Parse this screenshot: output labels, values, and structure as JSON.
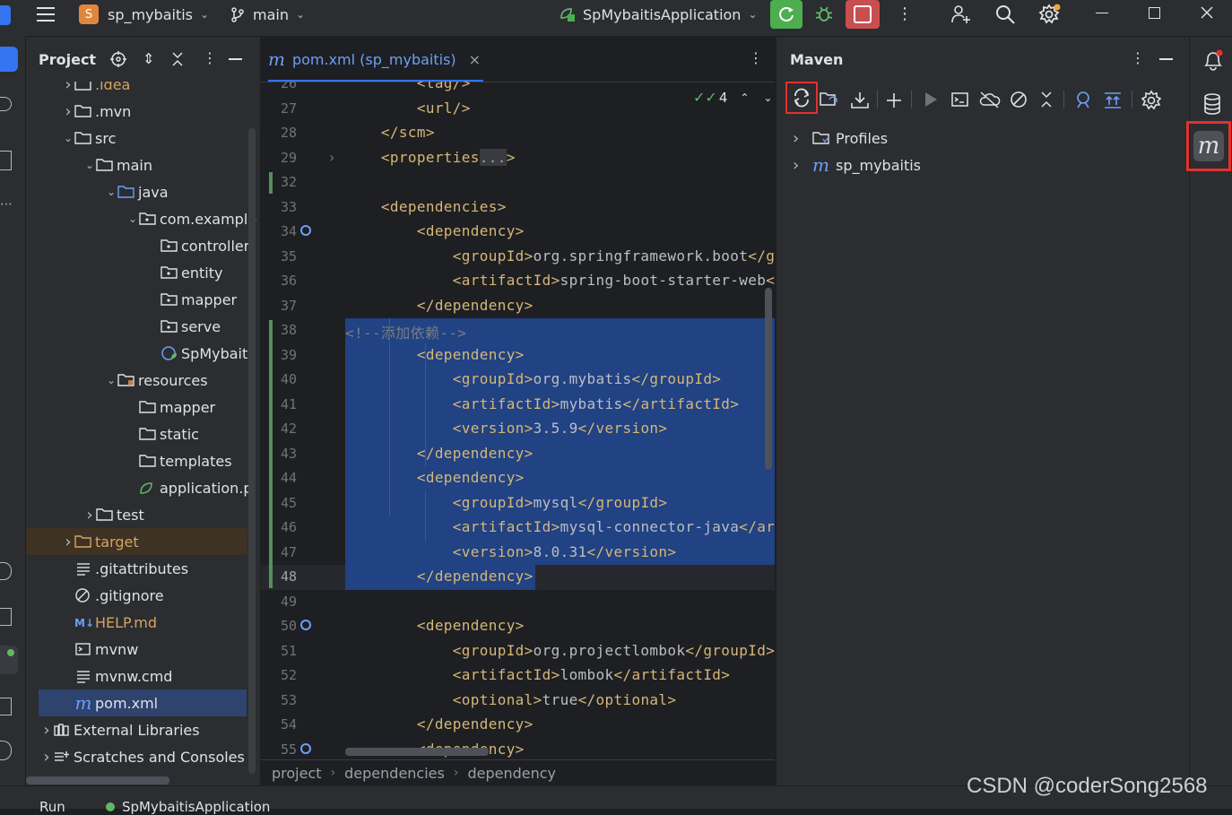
{
  "titlebar": {
    "project_badge": "S",
    "project_name": "sp_mybaitis",
    "branch": "main",
    "run_config": "SpMybaitisApplication"
  },
  "project_panel": {
    "title": "Project",
    "items": [
      {
        "label": ".idea",
        "depth": 2,
        "chevron": "right",
        "icon": "folder",
        "partial": true
      },
      {
        "label": ".mvn",
        "depth": 2,
        "chevron": "right",
        "icon": "folder"
      },
      {
        "label": "src",
        "depth": 2,
        "chevron": "down",
        "icon": "folder"
      },
      {
        "label": "main",
        "depth": 3,
        "chevron": "down",
        "icon": "folder"
      },
      {
        "label": "java",
        "depth": 4,
        "chevron": "down",
        "icon": "source-folder"
      },
      {
        "label": "com.example",
        "depth": 5,
        "chevron": "down",
        "icon": "package"
      },
      {
        "label": "controller",
        "depth": 6,
        "chevron": "",
        "icon": "package"
      },
      {
        "label": "entity",
        "depth": 6,
        "chevron": "",
        "icon": "package"
      },
      {
        "label": "mapper",
        "depth": 6,
        "chevron": "",
        "icon": "package"
      },
      {
        "label": "serve",
        "depth": 6,
        "chevron": "",
        "icon": "package"
      },
      {
        "label": "SpMybaiti",
        "depth": 6,
        "chevron": "",
        "icon": "spring-class"
      },
      {
        "label": "resources",
        "depth": 4,
        "chevron": "down",
        "icon": "resource-folder"
      },
      {
        "label": "mapper",
        "depth": 5,
        "chevron": "",
        "icon": "folder"
      },
      {
        "label": "static",
        "depth": 5,
        "chevron": "",
        "icon": "folder"
      },
      {
        "label": "templates",
        "depth": 5,
        "chevron": "",
        "icon": "folder"
      },
      {
        "label": "application.p",
        "depth": 5,
        "chevron": "",
        "icon": "spring-config"
      },
      {
        "label": "test",
        "depth": 3,
        "chevron": "right",
        "icon": "folder"
      },
      {
        "label": "target",
        "depth": 2,
        "chevron": "right",
        "icon": "excluded-folder",
        "excluded": true
      },
      {
        "label": ".gitattributes",
        "depth": 2,
        "chevron": "",
        "icon": "text-file"
      },
      {
        "label": ".gitignore",
        "depth": 2,
        "chevron": "",
        "icon": "ignore-file"
      },
      {
        "label": "HELP.md",
        "depth": 2,
        "chevron": "",
        "icon": "markdown-file",
        "modified": true
      },
      {
        "label": "mvnw",
        "depth": 2,
        "chevron": "",
        "icon": "shell-file"
      },
      {
        "label": "mvnw.cmd",
        "depth": 2,
        "chevron": "",
        "icon": "text-file"
      },
      {
        "label": "pom.xml",
        "depth": 2,
        "chevron": "",
        "icon": "maven-file",
        "selected": true
      },
      {
        "label": "External Libraries",
        "depth": 1,
        "chevron": "right",
        "icon": "library"
      },
      {
        "label": "Scratches and Consoles",
        "depth": 1,
        "chevron": "right",
        "icon": "scratches"
      }
    ]
  },
  "editor": {
    "tab_label": "pom.xml (sp_mybaitis)",
    "inspection_count": "4",
    "lines": [
      {
        "n": "26",
        "parts": [
          [
            "tag",
            "        <tag/>"
          ]
        ],
        "partial_top": true
      },
      {
        "n": "27",
        "parts": [
          [
            "tag",
            "        <url/>"
          ]
        ]
      },
      {
        "n": "28",
        "parts": [
          [
            "tag",
            "    </scm>"
          ]
        ]
      },
      {
        "n": "29",
        "parts": [
          [
            "tag",
            "    <properties"
          ],
          [
            "fold",
            "..."
          ],
          [
            "tag",
            ">"
          ]
        ],
        "fold": true
      },
      {
        "n": "32",
        "parts": []
      },
      {
        "n": "33",
        "parts": [
          [
            "tag",
            "    <dependencies>"
          ]
        ]
      },
      {
        "n": "34",
        "parts": [
          [
            "tag",
            "        <dependency>"
          ]
        ],
        "marker": true
      },
      {
        "n": "35",
        "parts": [
          [
            "tag",
            "            <groupId>"
          ],
          [
            "txt",
            "org.springframework.boot"
          ],
          [
            "tag",
            "</g"
          ]
        ]
      },
      {
        "n": "36",
        "parts": [
          [
            "tag",
            "            <artifactId>"
          ],
          [
            "txt",
            "spring-boot-starter-web"
          ],
          [
            "tag",
            "<"
          ]
        ]
      },
      {
        "n": "37",
        "parts": [
          [
            "tag",
            "        </dependency>"
          ]
        ]
      },
      {
        "n": "38",
        "parts": [
          [
            "cmt",
            "<!--添加依赖-->"
          ]
        ],
        "sel": "full"
      },
      {
        "n": "39",
        "parts": [
          [
            "tag",
            "        <dependency>"
          ]
        ],
        "sel": "full"
      },
      {
        "n": "40",
        "parts": [
          [
            "tag",
            "            <groupId>"
          ],
          [
            "txt",
            "org.mybatis"
          ],
          [
            "tag",
            "</groupId>"
          ]
        ],
        "sel": "full"
      },
      {
        "n": "41",
        "parts": [
          [
            "tag",
            "            <artifactId>"
          ],
          [
            "txt",
            "mybatis"
          ],
          [
            "tag",
            "</artifactId>"
          ]
        ],
        "sel": "full"
      },
      {
        "n": "42",
        "parts": [
          [
            "tag",
            "            <version>"
          ],
          [
            "txt",
            "3.5.9"
          ],
          [
            "tag",
            "</version>"
          ]
        ],
        "sel": "full"
      },
      {
        "n": "43",
        "parts": [
          [
            "tag",
            "        </dependency>"
          ]
        ],
        "sel": "full"
      },
      {
        "n": "44",
        "parts": [
          [
            "tag",
            "        <dependency>"
          ]
        ],
        "sel": "full"
      },
      {
        "n": "45",
        "parts": [
          [
            "tag",
            "            <groupId>"
          ],
          [
            "txt",
            "mysql"
          ],
          [
            "tag",
            "</groupId>"
          ]
        ],
        "sel": "full"
      },
      {
        "n": "46",
        "parts": [
          [
            "tag",
            "            <artifactId>"
          ],
          [
            "txt",
            "mysql-connector-java"
          ],
          [
            "tag",
            "</ar"
          ]
        ],
        "sel": "full"
      },
      {
        "n": "47",
        "parts": [
          [
            "tag",
            "            <version>"
          ],
          [
            "txt",
            "8.0.31"
          ],
          [
            "tag",
            "</version>"
          ]
        ],
        "sel": "full"
      },
      {
        "n": "48",
        "parts": [
          [
            "tag",
            "        </dependency>"
          ]
        ],
        "sel": "part",
        "current": true
      },
      {
        "n": "49",
        "parts": []
      },
      {
        "n": "50",
        "parts": [
          [
            "tag",
            "        <dependency>"
          ]
        ],
        "marker": true
      },
      {
        "n": "51",
        "parts": [
          [
            "tag",
            "            <groupId>"
          ],
          [
            "txt",
            "org.projectlombok"
          ],
          [
            "tag",
            "</groupId>"
          ]
        ]
      },
      {
        "n": "52",
        "parts": [
          [
            "tag",
            "            <artifactId>"
          ],
          [
            "txt",
            "lombok"
          ],
          [
            "tag",
            "</artifactId>"
          ]
        ]
      },
      {
        "n": "53",
        "parts": [
          [
            "tag",
            "            <optional>"
          ],
          [
            "txt",
            "true"
          ],
          [
            "tag",
            "</optional>"
          ]
        ]
      },
      {
        "n": "54",
        "parts": [
          [
            "tag",
            "        </dependency>"
          ]
        ]
      },
      {
        "n": "55",
        "parts": [
          [
            "tag",
            "        <dependency>"
          ]
        ],
        "marker": true
      }
    ],
    "breadcrumbs": [
      "project",
      "dependencies",
      "dependency"
    ]
  },
  "maven": {
    "title": "Maven",
    "tree": [
      {
        "label": "Profiles",
        "icon": "folder"
      },
      {
        "label": "sp_mybaitis",
        "icon": "maven"
      }
    ]
  },
  "bottom": {
    "run_tab": "Run",
    "run_config": "SpMybaitisApplication",
    "watermark": "CSDN @coderSong2568"
  },
  "colors": {
    "highlight_red": "#e5302d",
    "selection": "#214283",
    "accent_green": "#4cae4f",
    "accent_blue": "#3574f0"
  }
}
